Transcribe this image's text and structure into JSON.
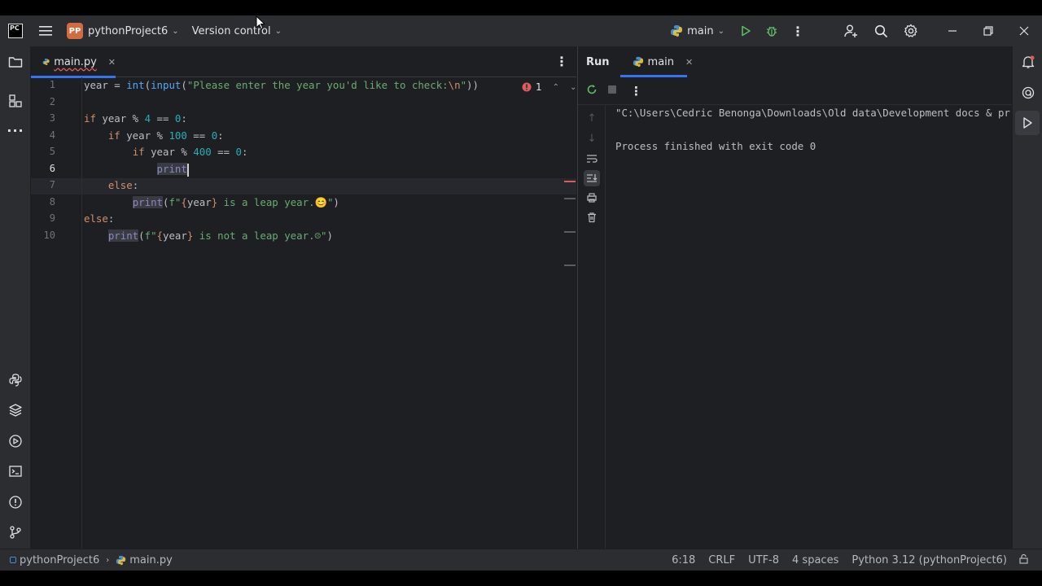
{
  "titlebar": {
    "app_logo": "PC",
    "project_badge": "PP",
    "project_name": "pythonProject6",
    "vcs_label": "Version control",
    "run_config": "main",
    "icons": [
      "hamburger-menu-icon",
      "python-icon",
      "run-icon",
      "debug-icon",
      "more-icon",
      "user-add-icon",
      "search-icon",
      "gear-icon",
      "minimize-icon",
      "restore-icon",
      "close-icon"
    ]
  },
  "editor": {
    "tab_label": "main.py",
    "error_count": "1",
    "line_numbers": [
      "1",
      "2",
      "3",
      "4",
      "5",
      "6",
      "7",
      "8",
      "9",
      "10"
    ],
    "lines": [
      "year = int(input(\"Please enter the year you'd like to check:\\n\"))",
      "",
      "if year % 4 == 0:",
      "    if year % 100 == 0:",
      "        if year % 400 == 0:",
      "            print",
      "    else:",
      "        print(f\"{year} is a leap year.😊\")",
      "else:",
      "    print(f\"{year} is not a leap year.☹\")"
    ],
    "current_line": "6"
  },
  "run": {
    "tool_label": "Run",
    "tab_label": "main",
    "console_lines": [
      "\"C:\\Users\\Cedric Benonga\\Downloads\\Old data\\Development docs & pr",
      "",
      "Process finished with exit code 0"
    ]
  },
  "status": {
    "breadcrumb_project": "pythonProject6",
    "breadcrumb_file": "main.py",
    "position": "6:18",
    "line_sep": "CRLF",
    "encoding": "UTF-8",
    "indent": "4 spaces",
    "interpreter": "Python 3.12 (pythonProject6)"
  },
  "colors": {
    "accent": "#3574f0",
    "error": "#db5c5c",
    "run_green": "#5fb865",
    "project_badge": "#d16b40"
  }
}
